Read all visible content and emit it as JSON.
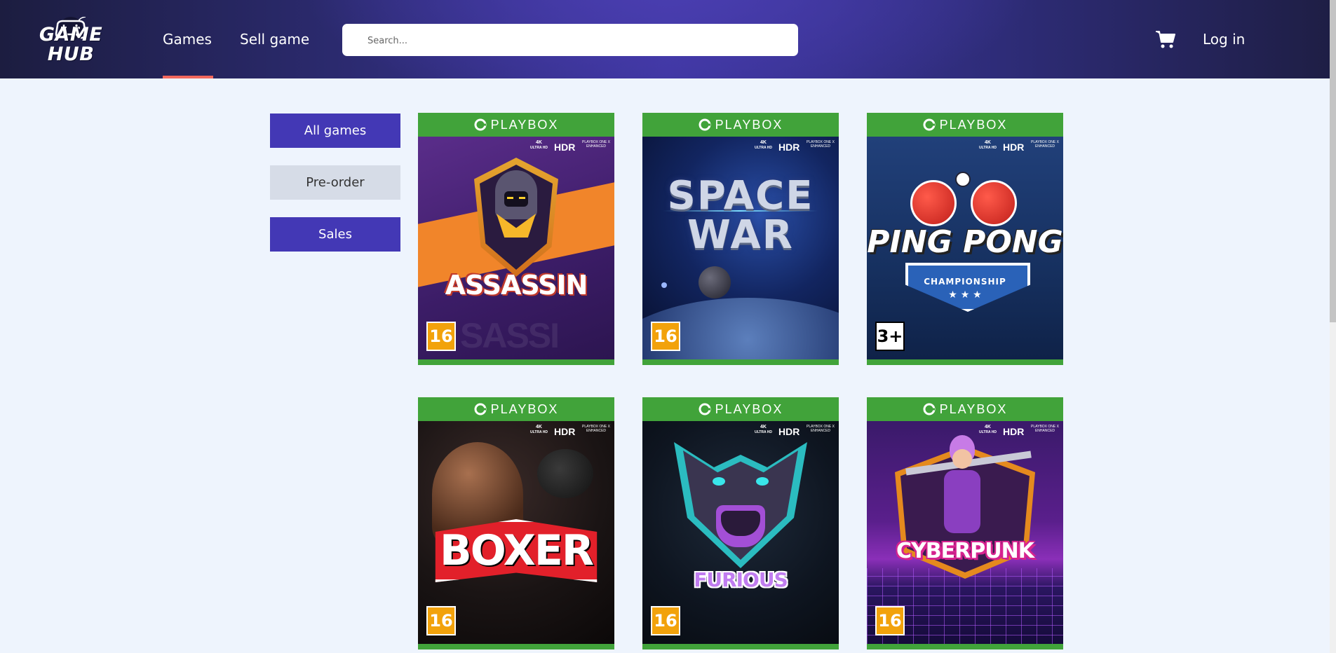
{
  "header": {
    "logo_text": "GAME HUB",
    "nav": {
      "games": "Games",
      "sell": "Sell game"
    },
    "search": {
      "placeholder": "Search..."
    },
    "login": "Log in"
  },
  "filters": [
    "All games",
    "Pre-order",
    "Sales"
  ],
  "games": [
    {
      "platform": "PLAYBOX",
      "title": "ASSASSIN",
      "rating": "16",
      "hdr": "HDR",
      "res": "4K",
      "res_sub": "ULTRA HD",
      "enhanced": "PLAYBOX ONE X ENHANCED"
    },
    {
      "platform": "PLAYBOX",
      "title": "SPACE WAR",
      "title_top": "SPACE",
      "title_bottom": "WAR",
      "rating": "16",
      "hdr": "HDR",
      "res": "4K",
      "res_sub": "ULTRA HD",
      "enhanced": "PLAYBOX ONE X ENHANCED"
    },
    {
      "platform": "PLAYBOX",
      "title": "PING PONG",
      "subtitle": "CHAMPIONSHIP",
      "rating": "3+",
      "hdr": "HDR",
      "res": "4K",
      "res_sub": "ULTRA HD",
      "enhanced": "PLAYBOX ONE X ENHANCED"
    },
    {
      "platform": "PLAYBOX",
      "title": "BOXER",
      "rating": "16",
      "hdr": "HDR",
      "res": "4K",
      "res_sub": "ULTRA HD",
      "enhanced": "PLAYBOX ONE X ENHANCED"
    },
    {
      "platform": "PLAYBOX",
      "title": "FURIOUS",
      "rating": "16",
      "hdr": "HDR",
      "res": "4K",
      "res_sub": "ULTRA HD",
      "enhanced": "PLAYBOX ONE X ENHANCED"
    },
    {
      "platform": "PLAYBOX",
      "title": "CYBERPUNK",
      "rating": "16",
      "hdr": "HDR",
      "res": "4K",
      "res_sub": "ULTRA HD",
      "enhanced": "PLAYBOX ONE X ENHANCED"
    }
  ],
  "colors": {
    "accent": "#4338b5",
    "underline": "#f2685c",
    "platform_green": "#41a33a",
    "background": "#eef4fd"
  }
}
